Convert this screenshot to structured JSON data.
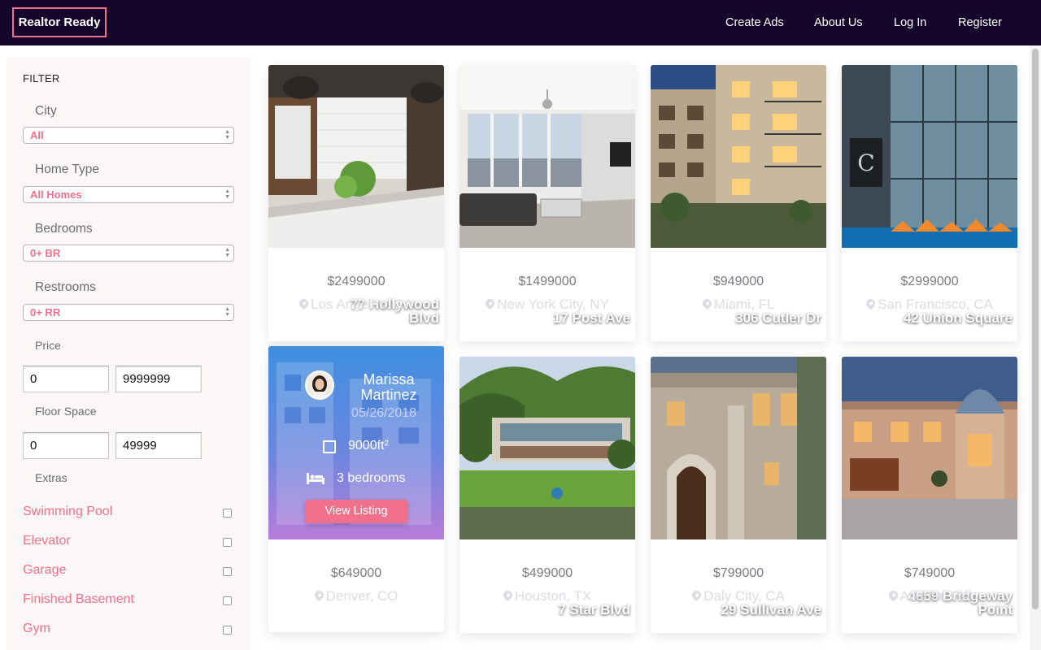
{
  "nav": {
    "brand": "Realtor Ready",
    "links": [
      "Create Ads",
      "About Us",
      "Log In",
      "Register"
    ]
  },
  "filter": {
    "title": "FILTER",
    "city": {
      "label": "City",
      "value": "All"
    },
    "home_type": {
      "label": "Home Type",
      "value": "All Homes"
    },
    "bedrooms": {
      "label": "Bedrooms",
      "value": "0+ BR"
    },
    "restrooms": {
      "label": "Restrooms",
      "value": "0+ RR"
    },
    "price": {
      "label": "Price",
      "min": "0",
      "max": "9999999"
    },
    "floor_space": {
      "label": "Floor Space",
      "min": "0",
      "max": "49999"
    },
    "extras": {
      "label": "Extras",
      "items": [
        "Swimming Pool",
        "Elevator",
        "Garage",
        "Finished Basement",
        "Gym"
      ]
    }
  },
  "listings": [
    {
      "address": "77 Hollywood Blvd",
      "price": "$2499000",
      "location": "Los Angeles, CA"
    },
    {
      "address": "17 Post Ave",
      "price": "$1499000",
      "location": "New York City, NY"
    },
    {
      "address": "306 Cutler Dr",
      "price": "$949000",
      "location": "Miami, FL"
    },
    {
      "address": "42 Union Square",
      "price": "$2999000",
      "location": "San Francisco, CA"
    },
    {
      "address": "",
      "price": "$649000",
      "location": "Denver, CO"
    },
    {
      "address": "7 Star Blvd",
      "price": "$499000",
      "location": "Houston, TX"
    },
    {
      "address": "29 Sullivan Ave",
      "price": "$799000",
      "location": "Daly City, CA"
    },
    {
      "address": "4659 Bridgeway Point",
      "price": "$749000",
      "location": "Atlanta, GA"
    }
  ],
  "hover_card": {
    "agent_name": "Marissa Martinez",
    "date": "05/26/2018",
    "floor_space": "9000ft²",
    "bedrooms": "3 bedrooms",
    "button": "View Listing"
  },
  "colors": {
    "nav_bg": "#15072b",
    "accent": "#f2708c",
    "sidebar_bg": "#faf7f6"
  }
}
